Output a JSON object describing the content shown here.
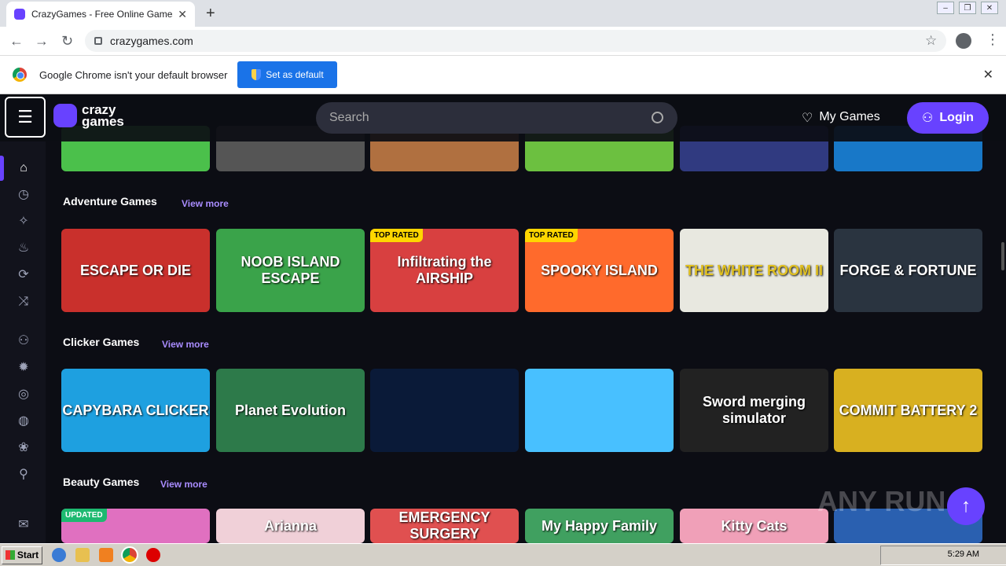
{
  "browser": {
    "tab_title": "CrazyGames - Free Online Games on CrazyGames.com",
    "url": "crazygames.com",
    "infobar_text": "Google Chrome isn't your default browser",
    "set_default_label": "Set as default"
  },
  "site": {
    "logo_line1": "crazy",
    "logo_line2": "games",
    "search_placeholder": "Search",
    "my_games_label": "My Games",
    "login_label": "Login",
    "sections": [
      {
        "title": "Adventure Games",
        "view_more": "View more",
        "cards": [
          {
            "label": "ESCAPE OR DIE",
            "badge": "",
            "color": "#c9302c"
          },
          {
            "label": "NOOB ISLAND ESCAPE",
            "badge": "",
            "color": "#3aa34a"
          },
          {
            "label": "Infiltrating the AIRSHIP",
            "badge": "TOP RATED",
            "color": "#d84040"
          },
          {
            "label": "SPOOKY ISLAND",
            "badge": "TOP RATED",
            "color": "#ff6a2c"
          },
          {
            "label": "THE WHITE ROOM II",
            "badge": "",
            "color": "#e8e8e0"
          },
          {
            "label": "FORGE & FORTUNE",
            "badge": "",
            "color": "#2a3440"
          }
        ]
      },
      {
        "title": "Clicker Games",
        "view_more": "View more",
        "cards": [
          {
            "label": "CAPYBARA CLICKER",
            "badge": "",
            "color": "#1ea0e0"
          },
          {
            "label": "Planet Evolution",
            "badge": "",
            "color": "#2d7a4a"
          },
          {
            "label": "",
            "badge": "",
            "color": "#0a1a38"
          },
          {
            "label": "",
            "badge": "",
            "color": "#48c0ff"
          },
          {
            "label": "Sword merging simulator",
            "badge": "",
            "color": "#222222"
          },
          {
            "label": "COMMIT BATTERY 2",
            "badge": "",
            "color": "#d8b020"
          }
        ]
      },
      {
        "title": "Beauty Games",
        "view_more": "View more",
        "cards": [
          {
            "label": "",
            "badge": "UPDATED",
            "color": "#e070c0"
          },
          {
            "label": "Arianna",
            "badge": "",
            "color": "#f0d0d8"
          },
          {
            "label": "EMERGENCY SURGERY",
            "badge": "",
            "color": "#e05050"
          },
          {
            "label": "My Happy Family",
            "badge": "",
            "color": "#40a060"
          },
          {
            "label": "Kitty Cats",
            "badge": "",
            "color": "#f0a0b8"
          },
          {
            "label": "",
            "badge": "",
            "color": "#2a60b0"
          }
        ]
      }
    ]
  },
  "watermark": "ANY RUN",
  "taskbar": {
    "start_label": "Start",
    "clock": "5:29 AM"
  }
}
